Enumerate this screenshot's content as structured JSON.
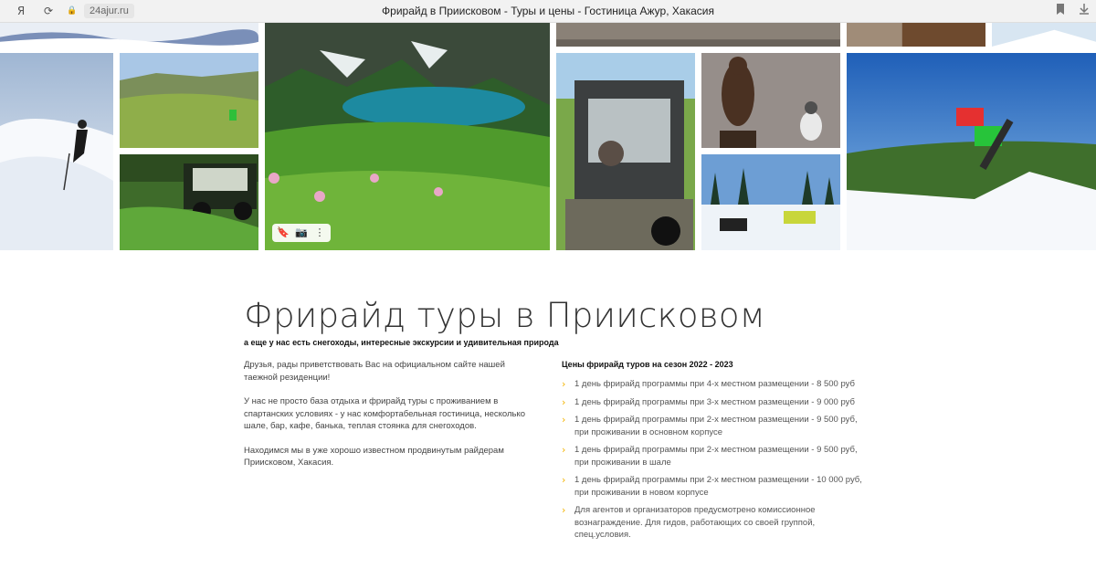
{
  "browser": {
    "yandex_icon": "Я",
    "reload_icon": "⟳",
    "lock_icon": "🔒",
    "url": "24ajur.ru",
    "tab_title": "Фрирайд в Приисковом - Туры и цены - Гостиница Ажур, Хакасия",
    "bookmark_icon": "bookmark-icon",
    "download_icon": "download-icon"
  },
  "gallery": {
    "photos": [
      "snow-top-left",
      "snow-top-mid",
      "lake-valley",
      "road-top",
      "interior-top",
      "snow-top-right",
      "skier-powder",
      "green-meadow",
      "atv-grass",
      "buggy-driver",
      "bear-husky",
      "snowmobiles",
      "snowboarder-jump"
    ],
    "toolbar": {
      "bookmark": "🔖",
      "camera": "📷",
      "more": "⋮"
    }
  },
  "content": {
    "title": "Фрирайд туры в Приисковом",
    "subtitle": "а еще у нас есть снегоходы, интересные экскурсии и удивительная природа",
    "intro": [
      "Друзья, рады приветствовать Вас на официальном сайте нашей таежной резиденции!",
      "У нас не просто база отдыха и фрирайд туры с проживанием в спартанских условиях - у нас комфортабельная гостиница, несколько шале, бар, кафе, банька, теплая стоянка для снегоходов.",
      "Находимся мы в уже хорошо известном продвинутым райдерам Приисковом, Хакасия."
    ],
    "prices_title": "Цены фрирайд туров на сезон 2022 - 2023",
    "prices": [
      "1 день фрирайд программы при 4-х местном размещении - 8 500 руб",
      "1 день фрирайд программы при 3-х местном размещении - 9 000 руб",
      "1 день фрирайд программы при 2-х местном размещении - 9 500 руб, при проживании в основном корпусе",
      "1 день фрирайд программы при 2-х местном размещении - 9 500 руб, при проживании в шале",
      "1 день фрирайд программы при 2-х местном размещении - 10 000 руб, при проживании в новом корпусе",
      "Для агентов и организаторов предусмотрено комиссионное вознаграждение. Для гидов, работающих со своей группой, спец.условия."
    ],
    "chevron": "›"
  },
  "colors": {
    "accent": "#f4b400"
  }
}
